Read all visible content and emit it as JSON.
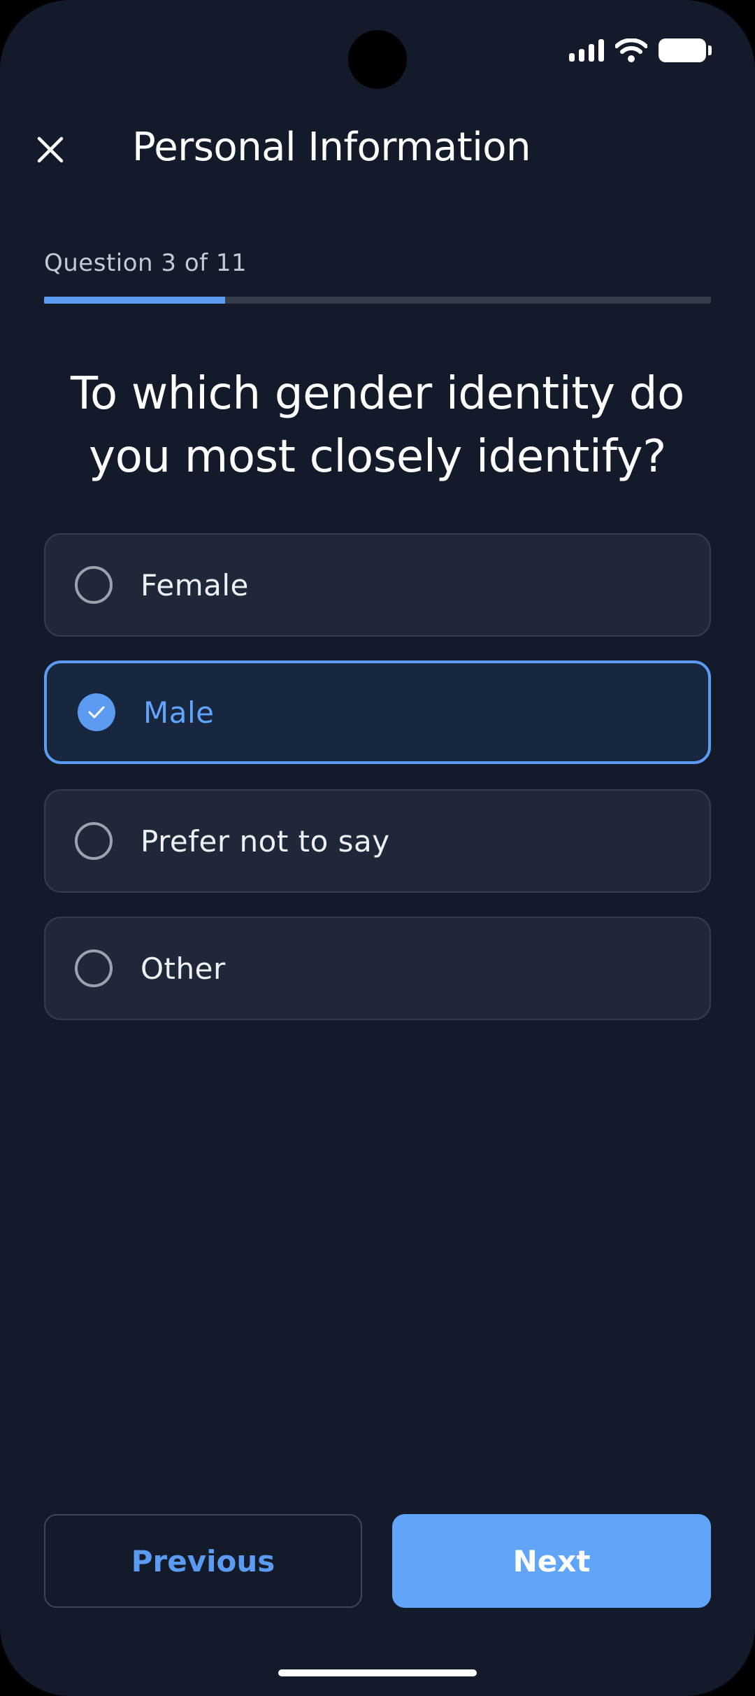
{
  "status_bar": {
    "icons": [
      "signal-icon",
      "wifi-icon",
      "battery-icon"
    ]
  },
  "header": {
    "title": "Personal Information",
    "close_icon": "close-icon"
  },
  "progress": {
    "label": "Question 3 of 11",
    "current": 3,
    "total": 11,
    "fraction": 0.272
  },
  "question": {
    "text": "To which gender identity do you most closely identify?"
  },
  "options": [
    {
      "label": "Female",
      "selected": false
    },
    {
      "label": "Male",
      "selected": true
    },
    {
      "label": "Prefer not to say",
      "selected": false
    },
    {
      "label": "Other",
      "selected": false
    }
  ],
  "footer": {
    "previous_label": "Previous",
    "next_label": "Next"
  },
  "colors": {
    "background": "#131a2a",
    "accent": "#60a5fa",
    "option_bg": "#1f2838",
    "selected_bg": "#182640"
  }
}
